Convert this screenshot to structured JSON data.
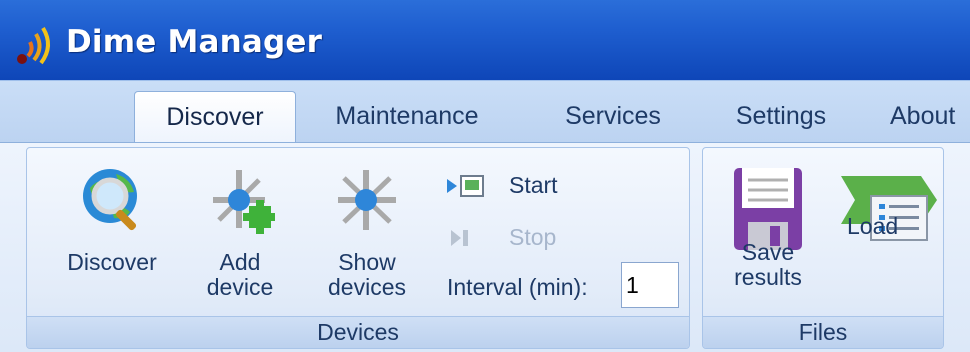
{
  "window": {
    "title": "Dime Manager",
    "icon": "signal-icon"
  },
  "tabs": [
    {
      "label": "Discover",
      "active": true
    },
    {
      "label": "Maintenance",
      "active": false
    },
    {
      "label": "Services",
      "active": false
    },
    {
      "label": "Settings",
      "active": false
    },
    {
      "label": "About",
      "active": false
    }
  ],
  "groups": {
    "devices": {
      "label": "Devices",
      "discover_label": "Discover",
      "add_device_label_1": "Add",
      "add_device_label_2": "device",
      "show_devices_label_1": "Show",
      "show_devices_label_2": "devices",
      "start_label": "Start",
      "stop_label": "Stop",
      "interval_label": "Interval (min):",
      "interval_value": "1"
    },
    "files": {
      "label": "Files",
      "save_label_1": "Save",
      "save_label_2": "results",
      "load_label": "Load"
    }
  },
  "colors": {
    "titlebar": "#1f5fd0",
    "ribbon": "#dce8f8",
    "text": "#1e3a66",
    "disabled": "#a7b6cc"
  }
}
